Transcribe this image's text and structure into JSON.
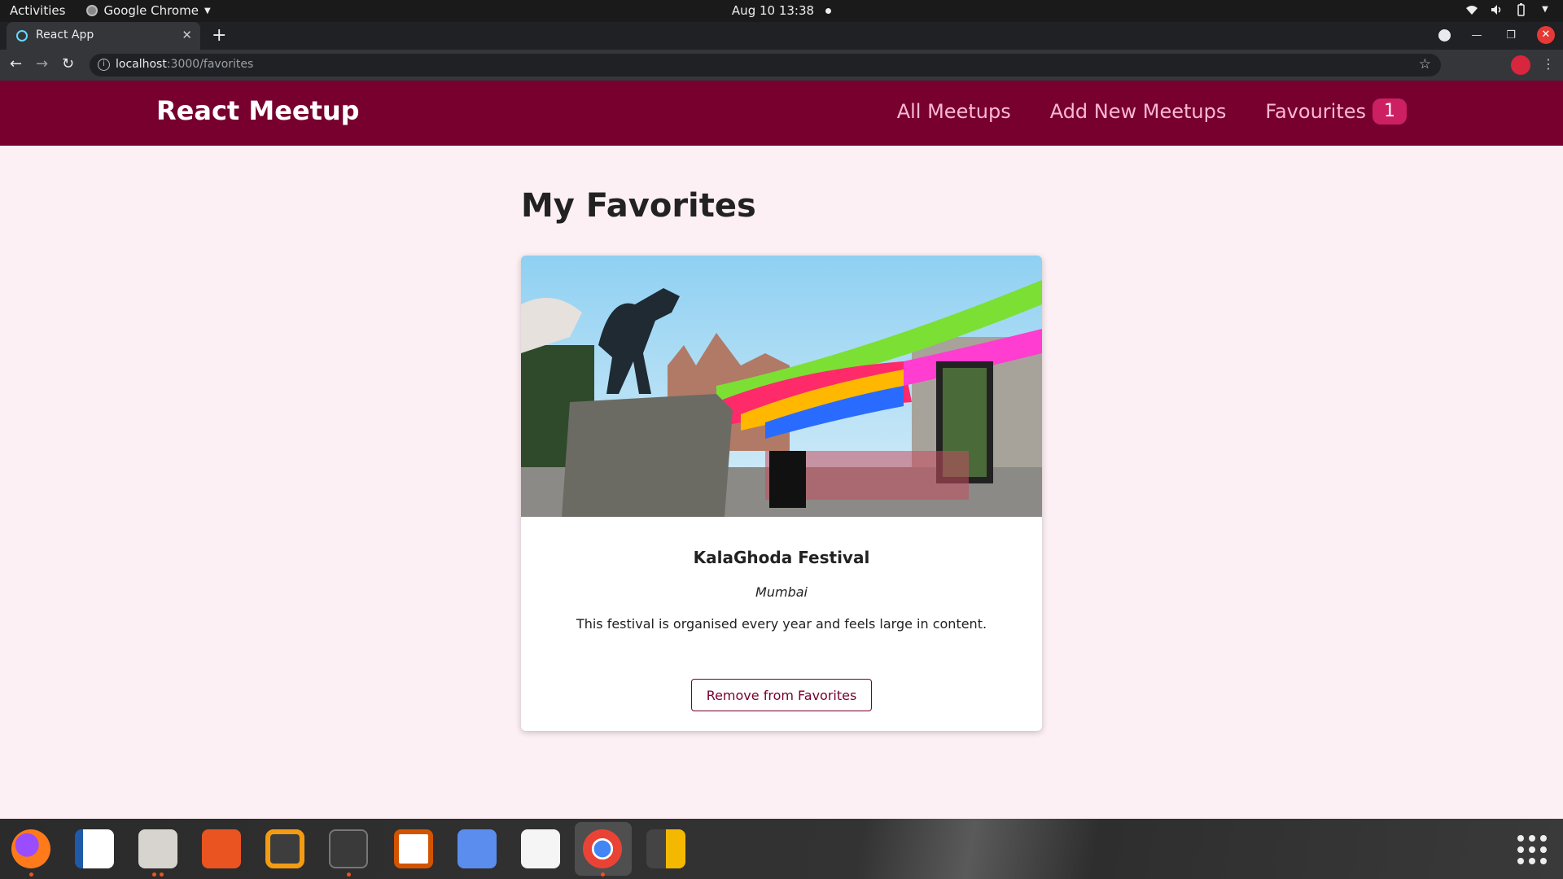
{
  "system_bar": {
    "activities": "Activities",
    "app_name": "Google Chrome",
    "datetime": "Aug 10  13:38"
  },
  "browser": {
    "tab_title": "React App",
    "url_host": "localhost",
    "url_path": ":3000/favorites"
  },
  "header": {
    "logo": "React Meetup",
    "nav": {
      "all_meetups": "All Meetups",
      "add_new": "Add New Meetups",
      "favourites": "Favourites",
      "favourites_count": "1"
    }
  },
  "main": {
    "title": "My Favorites",
    "card": {
      "title": "KalaGhoda Festival",
      "address": "Mumbai",
      "description": "This festival is organised every year and feels large in content.",
      "button": "Remove from Favorites"
    }
  },
  "colors": {
    "header_bg": "#77002e",
    "nav_text": "#fcb8d2",
    "badge_bg": "#cc2062",
    "page_bg": "#fdf0f4"
  }
}
